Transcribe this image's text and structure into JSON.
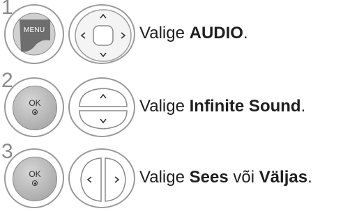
{
  "steps": [
    {
      "number": "1",
      "button_label": "MENU",
      "pad_type": "four-way",
      "text_prefix": "Valige ",
      "text_bold1": "AUDIO",
      "text_mid": "",
      "text_bold2": "",
      "text_suffix": "."
    },
    {
      "number": "2",
      "button_label": "OK",
      "pad_type": "up-down",
      "text_prefix": "Valige ",
      "text_bold1": "Infinite Sound",
      "text_mid": "",
      "text_bold2": "",
      "text_suffix": "."
    },
    {
      "number": "3",
      "button_label": "OK",
      "pad_type": "left-right",
      "text_prefix": "Valige ",
      "text_bold1": "Sees",
      "text_mid": " või ",
      "text_bold2": "Väljas",
      "text_suffix": "."
    }
  ],
  "icons": {
    "menu_button": "menu-button-icon",
    "ok_button": "ok-button-icon",
    "four_way_pad": "four-way-navigation-icon",
    "up_down_pad": "up-down-navigation-icon",
    "left_right_pad": "left-right-navigation-icon"
  },
  "colors": {
    "text": "#1f1f1f",
    "step_number": "#8a8a8a",
    "button_gray": "#b4b4b4",
    "menu_key": "#6e6e6e"
  }
}
